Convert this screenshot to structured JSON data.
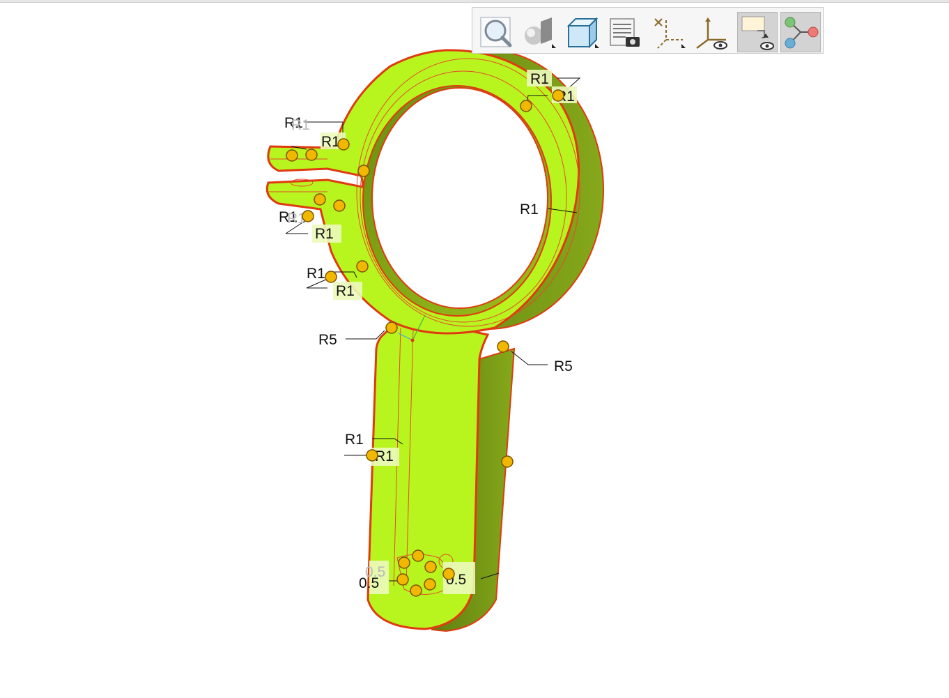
{
  "toolbar": {
    "buttons": [
      {
        "name": "zoom-fit",
        "icon": "magnifier-icon",
        "active": false
      },
      {
        "name": "display-style",
        "icon": "shaded-sphere-icon",
        "active": false
      },
      {
        "name": "saved-views",
        "icon": "cube-view-icon",
        "active": false
      },
      {
        "name": "annotation-list",
        "icon": "list-camera-icon",
        "active": false
      },
      {
        "name": "datum-display",
        "icon": "datum-axes-icon",
        "active": false
      },
      {
        "name": "coordinate-system",
        "icon": "csys-eye-icon",
        "active": false
      },
      {
        "name": "annotation-display",
        "icon": "annotation-eye-icon",
        "active": true
      },
      {
        "name": "model-tree",
        "icon": "node-tree-icon",
        "active": true
      }
    ]
  },
  "model": {
    "part_color": "#b8f51e",
    "side_color": "#6f8f12",
    "edge_color": "#e03a10",
    "handle_color": "#f2b800"
  },
  "dimensions": [
    {
      "text": "R1"
    },
    {
      "text": "R1"
    },
    {
      "text": "R1"
    },
    {
      "text": "R1"
    },
    {
      "text": "R1"
    },
    {
      "text": "R1"
    },
    {
      "text": "R1"
    },
    {
      "text": "R1"
    },
    {
      "text": "R1"
    },
    {
      "text": "R1"
    },
    {
      "text": "R1"
    },
    {
      "text": "R1"
    },
    {
      "text": "R5"
    },
    {
      "text": "R5"
    },
    {
      "text": "R1"
    },
    {
      "text": "R1"
    },
    {
      "text": "0.5"
    },
    {
      "text": "0.5"
    },
    {
      "text": "0.5"
    }
  ]
}
